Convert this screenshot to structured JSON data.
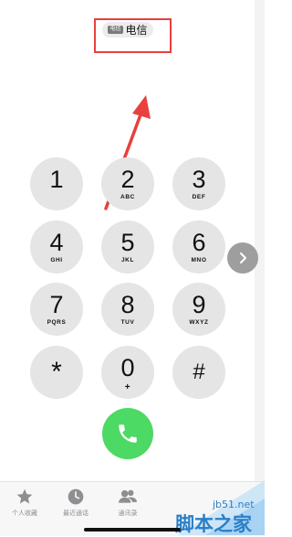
{
  "carrier": {
    "tag": "电信",
    "name": "电信"
  },
  "keypad": {
    "keys": [
      {
        "digit": "1",
        "letters": ""
      },
      {
        "digit": "2",
        "letters": "ABC"
      },
      {
        "digit": "3",
        "letters": "DEF"
      },
      {
        "digit": "4",
        "letters": "GHI"
      },
      {
        "digit": "5",
        "letters": "JKL"
      },
      {
        "digit": "6",
        "letters": "MNO"
      },
      {
        "digit": "7",
        "letters": "PQRS"
      },
      {
        "digit": "8",
        "letters": "TUV"
      },
      {
        "digit": "9",
        "letters": "WXYZ"
      },
      {
        "digit": "*",
        "letters": ""
      },
      {
        "digit": "0",
        "letters": "+"
      },
      {
        "digit": "#",
        "letters": ""
      }
    ]
  },
  "tabbar": {
    "favorites": "个人收藏",
    "recents": "最近通话",
    "contacts": "通讯录"
  },
  "watermark": {
    "site": "jb51.net",
    "name": "脚本之家"
  },
  "colors": {
    "call_green": "#4cd964",
    "highlight_red": "#e8403d",
    "key_gray": "#e5e5e5"
  }
}
